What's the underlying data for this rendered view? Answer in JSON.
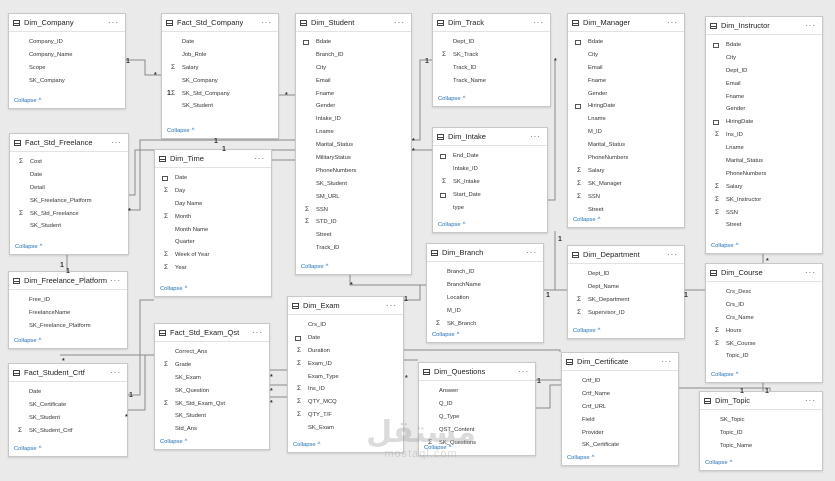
{
  "tables": [
    {
      "id": "dim_company",
      "name": "Dim_Company",
      "fields": [
        {
          "n": "Company_ID",
          "i": ""
        },
        {
          "n": "Company_Name",
          "i": ""
        },
        {
          "n": "Scope",
          "i": ""
        },
        {
          "n": "SK_Company",
          "i": ""
        }
      ]
    },
    {
      "id": "fact_std_company",
      "name": "Fact_Std_Company",
      "fields": [
        {
          "n": "Date",
          "i": ""
        },
        {
          "n": "Job_Role",
          "i": ""
        },
        {
          "n": "Salary",
          "i": "sum"
        },
        {
          "n": "SK_Company",
          "i": ""
        },
        {
          "n": "SK_Std_Company",
          "i": "sum"
        },
        {
          "n": "SK_Student",
          "i": ""
        }
      ]
    },
    {
      "id": "dim_student",
      "name": "Dim_Student",
      "fields": [
        {
          "n": "Bdate",
          "i": "cal"
        },
        {
          "n": "Branch_ID",
          "i": ""
        },
        {
          "n": "City",
          "i": ""
        },
        {
          "n": "Email",
          "i": ""
        },
        {
          "n": "Fname",
          "i": ""
        },
        {
          "n": "Gender",
          "i": ""
        },
        {
          "n": "Intake_ID",
          "i": ""
        },
        {
          "n": "Lname",
          "i": ""
        },
        {
          "n": "Marital_Status",
          "i": ""
        },
        {
          "n": "MilitaryStatus",
          "i": ""
        },
        {
          "n": "PhoneNumbers",
          "i": ""
        },
        {
          "n": "SK_Student",
          "i": ""
        },
        {
          "n": "SM_URL",
          "i": ""
        },
        {
          "n": "SSN",
          "i": "sum"
        },
        {
          "n": "STD_ID",
          "i": "sum"
        },
        {
          "n": "Street",
          "i": ""
        },
        {
          "n": "Track_ID",
          "i": ""
        }
      ]
    },
    {
      "id": "dim_track",
      "name": "Dim_Track",
      "fields": [
        {
          "n": "Dept_ID",
          "i": ""
        },
        {
          "n": "SK_Track",
          "i": "sum"
        },
        {
          "n": "Track_ID",
          "i": ""
        },
        {
          "n": "Track_Name",
          "i": ""
        }
      ]
    },
    {
      "id": "dim_manager",
      "name": "Dim_Manager",
      "fields": [
        {
          "n": "Bdate",
          "i": "cal"
        },
        {
          "n": "City",
          "i": ""
        },
        {
          "n": "Email",
          "i": ""
        },
        {
          "n": "Fname",
          "i": ""
        },
        {
          "n": "Gender",
          "i": ""
        },
        {
          "n": "HiringDate",
          "i": "cal"
        },
        {
          "n": "Lname",
          "i": ""
        },
        {
          "n": "M_ID",
          "i": ""
        },
        {
          "n": "Marital_Status",
          "i": ""
        },
        {
          "n": "PhoneNumbers",
          "i": ""
        },
        {
          "n": "Salary",
          "i": "sum"
        },
        {
          "n": "SK_Manager",
          "i": "sum"
        },
        {
          "n": "SSN",
          "i": "sum"
        },
        {
          "n": "Street",
          "i": ""
        }
      ]
    },
    {
      "id": "dim_instructor",
      "name": "Dim_Instructor",
      "fields": [
        {
          "n": "Bdate",
          "i": "cal"
        },
        {
          "n": "City",
          "i": ""
        },
        {
          "n": "Dept_ID",
          "i": ""
        },
        {
          "n": "Email",
          "i": ""
        },
        {
          "n": "Fname",
          "i": ""
        },
        {
          "n": "Gender",
          "i": ""
        },
        {
          "n": "HiringDate",
          "i": "cal"
        },
        {
          "n": "Ins_ID",
          "i": "sum"
        },
        {
          "n": "Lname",
          "i": ""
        },
        {
          "n": "Marital_Status",
          "i": ""
        },
        {
          "n": "PhoneNumbers",
          "i": ""
        },
        {
          "n": "Salary",
          "i": "sum"
        },
        {
          "n": "SK_Instructor",
          "i": "sum"
        },
        {
          "n": "SSN",
          "i": "sum"
        },
        {
          "n": "Street",
          "i": ""
        }
      ]
    },
    {
      "id": "fact_std_freelance",
      "name": "Fact_Std_Freelance",
      "fields": [
        {
          "n": "Cost",
          "i": "sum"
        },
        {
          "n": "Date",
          "i": ""
        },
        {
          "n": "Detail",
          "i": ""
        },
        {
          "n": "SK_Freelance_Platform",
          "i": ""
        },
        {
          "n": "SK_Std_Freelance",
          "i": "sum"
        },
        {
          "n": "SK_Student",
          "i": ""
        }
      ]
    },
    {
      "id": "dim_time",
      "name": "Dim_Time",
      "fields": [
        {
          "n": "Date",
          "i": "cal"
        },
        {
          "n": "Day",
          "i": "sum"
        },
        {
          "n": "Day Name",
          "i": ""
        },
        {
          "n": "Month",
          "i": "sum"
        },
        {
          "n": "Month Name",
          "i": ""
        },
        {
          "n": "Quarter",
          "i": ""
        },
        {
          "n": "Week of Year",
          "i": "sum"
        },
        {
          "n": "Year",
          "i": "sum"
        }
      ]
    },
    {
      "id": "dim_intake",
      "name": "Dim_Intake",
      "fields": [
        {
          "n": "End_Date",
          "i": "cal"
        },
        {
          "n": "Intake_ID",
          "i": ""
        },
        {
          "n": "SK_Intake",
          "i": "sum"
        },
        {
          "n": "Start_Date",
          "i": "cal"
        },
        {
          "n": "type",
          "i": ""
        }
      ]
    },
    {
      "id": "dim_branch",
      "name": "Dim_Branch",
      "fields": [
        {
          "n": "Branch_ID",
          "i": ""
        },
        {
          "n": "BranchName",
          "i": ""
        },
        {
          "n": "Location",
          "i": ""
        },
        {
          "n": "M_ID",
          "i": ""
        },
        {
          "n": "SK_Branch",
          "i": "sum"
        }
      ]
    },
    {
      "id": "dim_department",
      "name": "Dim_Department",
      "fields": [
        {
          "n": "Dept_ID",
          "i": ""
        },
        {
          "n": "Dept_Name",
          "i": ""
        },
        {
          "n": "SK_Department",
          "i": "sum"
        },
        {
          "n": "Supervisor_ID",
          "i": "sum"
        }
      ]
    },
    {
      "id": "dim_course",
      "name": "Dim_Course",
      "fields": [
        {
          "n": "Crs_Desc",
          "i": ""
        },
        {
          "n": "Crs_ID",
          "i": ""
        },
        {
          "n": "Crs_Name",
          "i": ""
        },
        {
          "n": "Hours",
          "i": "sum"
        },
        {
          "n": "SK_Course",
          "i": "sum"
        },
        {
          "n": "Topic_ID",
          "i": ""
        }
      ]
    },
    {
      "id": "dim_freelance_platform",
      "name": "Dim_Freelance_Platform",
      "fields": [
        {
          "n": "Free_ID",
          "i": ""
        },
        {
          "n": "FreelanceName",
          "i": ""
        },
        {
          "n": "SK_Freelance_Platform",
          "i": ""
        }
      ]
    },
    {
      "id": "dim_exam",
      "name": "Dim_Exam",
      "fields": [
        {
          "n": "Crs_ID",
          "i": ""
        },
        {
          "n": "Date",
          "i": "cal"
        },
        {
          "n": "Duration",
          "i": "sum"
        },
        {
          "n": "Exam_ID",
          "i": "sum"
        },
        {
          "n": "Exam_Type",
          "i": ""
        },
        {
          "n": "Ins_ID",
          "i": "sum"
        },
        {
          "n": "QTY_MCQ",
          "i": "sum"
        },
        {
          "n": "QTY_T/F",
          "i": "sum"
        },
        {
          "n": "SK_Exam",
          "i": ""
        }
      ]
    },
    {
      "id": "fact_std_exam_qst",
      "name": "Fact_Std_Exam_Qst",
      "fields": [
        {
          "n": "Correct_Ans",
          "i": ""
        },
        {
          "n": "Grade",
          "i": "sum"
        },
        {
          "n": "SK_Exam",
          "i": ""
        },
        {
          "n": "SK_Question",
          "i": ""
        },
        {
          "n": "SK_Std_Exam_Qst",
          "i": "sum"
        },
        {
          "n": "SK_Student",
          "i": ""
        },
        {
          "n": "Std_Ans",
          "i": ""
        }
      ]
    },
    {
      "id": "fact_student_crtf",
      "name": "Fact_Student_Crtf",
      "fields": [
        {
          "n": "Date",
          "i": ""
        },
        {
          "n": "SK_Certificate",
          "i": ""
        },
        {
          "n": "SK_Student",
          "i": ""
        },
        {
          "n": "SK_Student_Crtf",
          "i": "sum"
        }
      ]
    },
    {
      "id": "dim_questions",
      "name": "Dim_Questions",
      "fields": [
        {
          "n": "Answer",
          "i": ""
        },
        {
          "n": "Q_ID",
          "i": ""
        },
        {
          "n": "Q_Type",
          "i": ""
        },
        {
          "n": "QST_Content",
          "i": ""
        },
        {
          "n": "SK_Questions",
          "i": "sum"
        }
      ]
    },
    {
      "id": "dim_certificate",
      "name": "Dim_Certificate",
      "fields": [
        {
          "n": "Crtf_ID",
          "i": ""
        },
        {
          "n": "Crtf_Name",
          "i": ""
        },
        {
          "n": "Crtf_URL",
          "i": ""
        },
        {
          "n": "Field",
          "i": ""
        },
        {
          "n": "Provider",
          "i": ""
        },
        {
          "n": "SK_Certificate",
          "i": ""
        }
      ]
    },
    {
      "id": "dim_topic",
      "name": "Dim_Topic",
      "fields": [
        {
          "n": "SK_Topic",
          "i": ""
        },
        {
          "n": "Topic_ID",
          "i": ""
        },
        {
          "n": "Topic_Name",
          "i": ""
        }
      ]
    }
  ],
  "collapse_label": "Collapse",
  "cardinality": {
    "one": "1",
    "many": "*"
  },
  "watermark": {
    "arabic": "مستقل",
    "latin": "mostaql.com"
  }
}
